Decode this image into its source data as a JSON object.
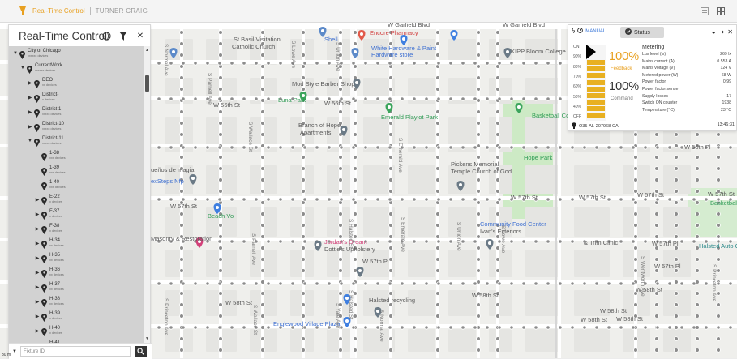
{
  "topbar": {
    "app_title": "Real-Time Control",
    "user_name": "TURNER CRAIG"
  },
  "panel": {
    "title": "Real-Time Control",
    "tree": [
      {
        "name": "City of Chicago",
        "count": "xxxxxx devices",
        "level": 0,
        "expanded": true
      },
      {
        "name": "CurrentWork",
        "count": "xxxxxx devices",
        "level": 1,
        "expanded": true
      },
      {
        "name": "DEO",
        "count": "xx devices",
        "level": 2,
        "expanded": false
      },
      {
        "name": "District-",
        "count": "x devices",
        "level": 2,
        "expanded": false
      },
      {
        "name": "District 1",
        "count": "xxxxx devices",
        "level": 2,
        "expanded": false
      },
      {
        "name": "District-10",
        "count": "xxxxx devices",
        "level": 2,
        "expanded": false
      },
      {
        "name": "District-11",
        "count": "xxxxx devices",
        "level": 2,
        "expanded": true
      },
      {
        "name": "1-38",
        "count": "xxx devices",
        "level": 3,
        "expanded": null
      },
      {
        "name": "1-39",
        "count": "xxx devices",
        "level": 3,
        "expanded": null
      },
      {
        "name": "1-40",
        "count": "xxx devices",
        "level": 3,
        "expanded": null
      },
      {
        "name": "E-22",
        "count": "x devices",
        "level": 3,
        "expanded": false
      },
      {
        "name": "F-37",
        "count": "x devices",
        "level": 3,
        "expanded": false
      },
      {
        "name": "F-38",
        "count": "x devices",
        "level": 3,
        "expanded": false
      },
      {
        "name": "H-34",
        "count": "xx devices",
        "level": 3,
        "expanded": false
      },
      {
        "name": "H-35",
        "count": "xx devices",
        "level": 3,
        "expanded": false
      },
      {
        "name": "H-36",
        "count": "xx devices",
        "level": 3,
        "expanded": false
      },
      {
        "name": "H-37",
        "count": "xx devices",
        "level": 3,
        "expanded": false
      },
      {
        "name": "H-38",
        "count": "xx devices",
        "level": 3,
        "expanded": false
      },
      {
        "name": "H-39",
        "count": "x devices",
        "level": 3,
        "expanded": false
      },
      {
        "name": "H-40",
        "count": "x devices",
        "level": 3,
        "expanded": false
      },
      {
        "name": "H-41",
        "count": "xx devices",
        "level": 3,
        "expanded": null
      },
      {
        "name": "I-34",
        "count": "xxx devices",
        "level": 3,
        "expanded": false
      }
    ],
    "search_placeholder": "Fixture ID"
  },
  "scale_label": "30 m",
  "realtime": {
    "tab_manual": "MANUAL",
    "tab_status": "Status",
    "scale_labels": [
      "ON",
      "90%",
      "80%",
      "70%",
      "60%",
      "50%",
      "40%",
      "OFF"
    ],
    "feedback_value": "100%",
    "feedback_label": "Feedback",
    "command_value": "100%",
    "command_label": "Command",
    "metering_title": "Metering",
    "metering": [
      {
        "label": "Lux level (lx)",
        "value": "269 lx"
      },
      {
        "label": "Mains current (A)",
        "value": "0.553 A"
      },
      {
        "label": "Mains voltage (V)",
        "value": "124 V"
      },
      {
        "label": "Metered power (W)",
        "value": "68 W"
      },
      {
        "label": "Power factor",
        "value": "0.99"
      },
      {
        "label": "Power factor sense",
        "value": ""
      },
      {
        "label": "Supply losses",
        "value": "17"
      },
      {
        "label": "Switch ON counter",
        "value": "1938"
      },
      {
        "label": "Temperature (°C)",
        "value": "23 °C"
      }
    ],
    "device_id": "O35-AL-207968-CA",
    "time": "13:46:31"
  },
  "map": {
    "labels": [
      {
        "text": "W Garfield Blvd",
        "style": ""
      },
      {
        "text": "W Garfield Blvd",
        "style": ""
      },
      {
        "text": "St Basil Visitation",
        "style": ""
      },
      {
        "text": "Catholic Church",
        "style": ""
      },
      {
        "text": "Shell",
        "style": "blue"
      },
      {
        "text": "Encore Pharmacy",
        "style": "red"
      },
      {
        "text": "White Hardware & Paint",
        "style": "blue"
      },
      {
        "text": "Hardware store",
        "style": "blue"
      },
      {
        "text": "KIPP Bloom College P",
        "style": ""
      },
      {
        "text": "Mod Style Barber Shop",
        "style": ""
      },
      {
        "text": "Luna Park",
        "style": "green"
      },
      {
        "text": "W 56th St",
        "style": ""
      },
      {
        "text": "W 56th St",
        "style": ""
      },
      {
        "text": "Emerald Playlot Park",
        "style": "green"
      },
      {
        "text": "Basketball Courts",
        "style": "green"
      },
      {
        "text": "Branch of Hope",
        "style": ""
      },
      {
        "text": "Apartments",
        "style": ""
      },
      {
        "text": "W 56th Pl",
        "style": ""
      },
      {
        "text": "Hope Park",
        "style": "green"
      },
      {
        "text": "Pickens Memorial",
        "style": ""
      },
      {
        "text": "Temple Church of God...",
        "style": ""
      },
      {
        "text": "ueños de magia",
        "style": ""
      },
      {
        "text": "exSteps Nfp",
        "style": "blue"
      },
      {
        "text": "W 57th St",
        "style": ""
      },
      {
        "text": "W 57th St",
        "style": ""
      },
      {
        "text": "W 57th St",
        "style": ""
      },
      {
        "text": "W 57th St",
        "style": ""
      },
      {
        "text": "W 57th St",
        "style": ""
      },
      {
        "text": "Basketball",
        "style": "green"
      },
      {
        "text": "Beach Vo",
        "style": "green"
      },
      {
        "text": "Community Food Center",
        "style": "blue"
      },
      {
        "text": "Ivan's Exteriors",
        "style": ""
      },
      {
        "text": "Masonry & Restoration",
        "style": ""
      },
      {
        "text": "Jordan's Dream",
        "style": "pink"
      },
      {
        "text": "Dottie's Upholstery",
        "style": ""
      },
      {
        "text": "& Trim Clinic",
        "style": ""
      },
      {
        "text": "W 57th Pl",
        "style": ""
      },
      {
        "text": "W 57th Pl",
        "style": ""
      },
      {
        "text": "W 57th Pl",
        "style": ""
      },
      {
        "text": "Halsted Auto Center",
        "style": "teal"
      },
      {
        "text": "W 58th St",
        "style": ""
      },
      {
        "text": "W 58th St",
        "style": ""
      },
      {
        "text": "W 58th St",
        "style": ""
      },
      {
        "text": "W 58th St",
        "style": ""
      },
      {
        "text": "Halsted recycling",
        "style": ""
      },
      {
        "text": "Englewood Village Plaza",
        "style": "blue"
      },
      {
        "text": "W 58th St",
        "style": ""
      },
      {
        "text": "W 58th St",
        "style": ""
      }
    ],
    "vlabels": [
      "S Normal Ave",
      "S Parnell Ave",
      "S Wallace St",
      "S Lowe Ave",
      "S Union Ave",
      "S Emerald Ave",
      "S Emerald Ave",
      "S Halsted St",
      "S Halsted St",
      "S Lowe Ave",
      "S Union Ave",
      "S Parnell Ave",
      "S Wallace St",
      "S Princeton Ave",
      "S Wentworth Ave",
      "S Princeton Ave",
      "S Yale Ave",
      "S Normal Ave"
    ]
  }
}
